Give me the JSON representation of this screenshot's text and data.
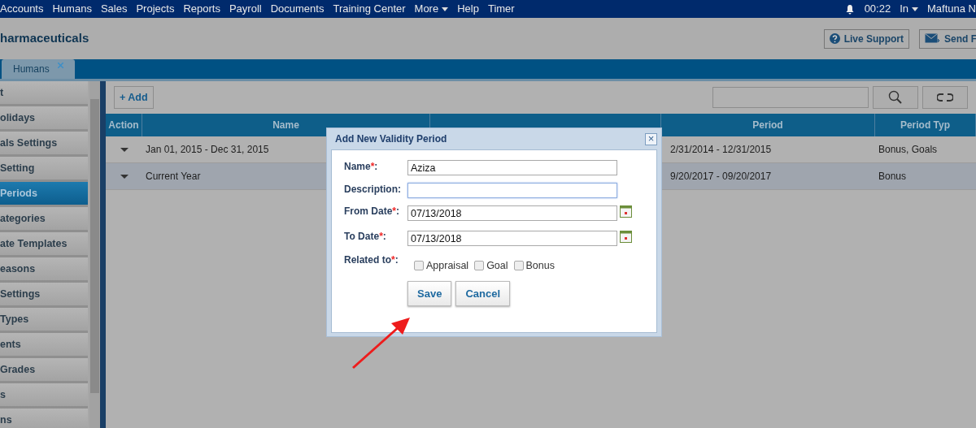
{
  "top_nav": {
    "items": [
      {
        "label": "Accounts",
        "dropdown": false
      },
      {
        "label": "Humans",
        "dropdown": false
      },
      {
        "label": "Sales",
        "dropdown": false
      },
      {
        "label": "Projects",
        "dropdown": false
      },
      {
        "label": "Reports",
        "dropdown": false
      },
      {
        "label": "Payroll",
        "dropdown": false
      },
      {
        "label": "Documents",
        "dropdown": false
      },
      {
        "label": "Training Center",
        "dropdown": false
      },
      {
        "label": "More",
        "dropdown": true
      },
      {
        "label": "Help",
        "dropdown": false
      },
      {
        "label": "Timer",
        "dropdown": false
      }
    ],
    "clock": "00:22",
    "status": "In",
    "user": "Maftuna N"
  },
  "company": "harmaceuticals",
  "header_buttons": [
    {
      "label": "Live Support",
      "kind": "help"
    },
    {
      "label": "Send F",
      "kind": "mail"
    }
  ],
  "tabs": [
    {
      "label": "Humans",
      "selected": true
    }
  ],
  "sidebar": {
    "items": [
      {
        "label": "t",
        "selected": false
      },
      {
        "label": "olidays",
        "selected": false
      },
      {
        "label": "als Settings",
        "selected": false
      },
      {
        "label": "Setting",
        "selected": false
      },
      {
        "label": "Periods",
        "selected": true
      },
      {
        "label": "ategories",
        "selected": false
      },
      {
        "label": "ate Templates",
        "selected": false
      },
      {
        "label": "easons",
        "selected": false
      },
      {
        "label": "Settings",
        "selected": false
      },
      {
        "label": "Types",
        "selected": false
      },
      {
        "label": "ents",
        "selected": false
      },
      {
        "label": "Grades",
        "selected": false
      },
      {
        "label": "s",
        "selected": false
      },
      {
        "label": "ns",
        "selected": false
      }
    ]
  },
  "toolbar": {
    "add_button": "+ Add"
  },
  "table": {
    "columns": [
      "Action",
      "Name",
      null,
      "Period",
      "Period Typ"
    ],
    "rows": [
      {
        "name": "Jan 01, 2015 - Dec 31, 2015",
        "period": "2/31/2014 - 12/31/2015",
        "period_type": "Bonus, Goals",
        "selected": false
      },
      {
        "name": "Current Year",
        "period": "9/20/2017 - 09/20/2017",
        "period_type": "Bonus",
        "selected": true
      }
    ]
  },
  "dialog": {
    "title": "Add New Validity Period",
    "close": "×",
    "fields": [
      {
        "label": "Name",
        "required_mark": "*",
        "label_end": ":",
        "kind": "text",
        "value": "Aziza",
        "focused": false
      },
      {
        "label": "Description",
        "label_end": ":",
        "kind": "text",
        "focused": true
      },
      {
        "label": "From Date",
        "required_mark": "*",
        "label_end": ":",
        "kind": "date",
        "value": "07/13/2018",
        "focused": false
      },
      {
        "label": "To Date",
        "required_mark": "*",
        "label_end": ":",
        "kind": "date",
        "value": "07/13/2018",
        "focused": false
      }
    ],
    "related": {
      "label": "Related to",
      "required_mark": "*",
      "label_end": ":",
      "options": [
        {
          "label": "Appraisal",
          "checked": false
        },
        {
          "label": "Goal",
          "checked": false
        },
        {
          "label": "Bonus",
          "checked": false
        }
      ]
    },
    "buttons": [
      "Save",
      "Cancel"
    ]
  }
}
